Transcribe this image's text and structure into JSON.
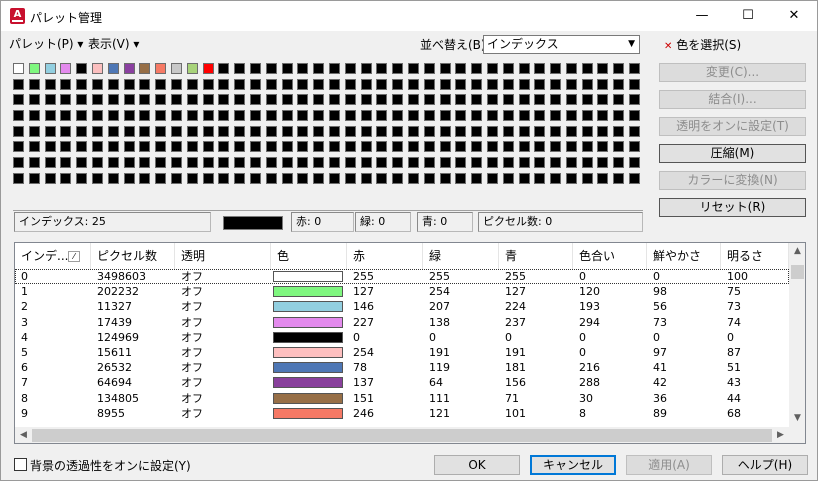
{
  "window": {
    "title": "パレット管理",
    "app_icon_letter": "A",
    "minimize": "—",
    "maximize": "☐",
    "close": "✕"
  },
  "menubar": {
    "palette_menu": "パレット(P) ▾",
    "view_menu": "表示(V) ▾",
    "sort_label": "並べ替え(B):",
    "sort_value": "インデックス",
    "pick_color": "色を選択(S)"
  },
  "palette": {
    "first_colors": [
      "#ffffff",
      "#7ff77f",
      "#92cfe0",
      "#e38aed",
      "#000000",
      "#fbbfbf",
      "#4e77b5",
      "#8a40a0",
      "#976f47",
      "#f67a65",
      "#c8c8c8",
      "#a8d37a",
      "#ff0000"
    ],
    "rest_color": "#000000",
    "total": 256
  },
  "side_buttons": {
    "change": "変更(C)...",
    "merge": "結合(I)...",
    "transparent_on": "透明をオンに設定(T)",
    "compress": "圧縮(M)",
    "convert": "カラーに変換(N)",
    "reset": "リセット(R)"
  },
  "info": {
    "index": "インデックス:  25",
    "red": "赤: 0",
    "green": "緑: 0",
    "blue": "青: 0",
    "pixels": "ピクセル数: 0",
    "current_color": "#000000"
  },
  "table": {
    "columns": [
      "インデ...",
      "ピクセル数",
      "透明",
      "色",
      "赤",
      "緑",
      "青",
      "色合い",
      "鮮やかさ",
      "明るさ"
    ],
    "rows": [
      {
        "idx": "0",
        "px": "3498603",
        "tr": "オフ",
        "color": "#ffffff",
        "r": "255",
        "g": "255",
        "b": "255",
        "h": "0",
        "s": "0",
        "l": "100"
      },
      {
        "idx": "1",
        "px": "202232",
        "tr": "オフ",
        "color": "#7ff77f",
        "r": "127",
        "g": "254",
        "b": "127",
        "h": "120",
        "s": "98",
        "l": "75"
      },
      {
        "idx": "2",
        "px": "11327",
        "tr": "オフ",
        "color": "#92cfe0",
        "r": "146",
        "g": "207",
        "b": "224",
        "h": "193",
        "s": "56",
        "l": "73"
      },
      {
        "idx": "3",
        "px": "17439",
        "tr": "オフ",
        "color": "#e38aed",
        "r": "227",
        "g": "138",
        "b": "237",
        "h": "294",
        "s": "73",
        "l": "74"
      },
      {
        "idx": "4",
        "px": "124969",
        "tr": "オフ",
        "color": "#000000",
        "r": "0",
        "g": "0",
        "b": "0",
        "h": "0",
        "s": "0",
        "l": "0"
      },
      {
        "idx": "5",
        "px": "15611",
        "tr": "オフ",
        "color": "#febfbf",
        "r": "254",
        "g": "191",
        "b": "191",
        "h": "0",
        "s": "97",
        "l": "87"
      },
      {
        "idx": "6",
        "px": "26532",
        "tr": "オフ",
        "color": "#4e77b5",
        "r": "78",
        "g": "119",
        "b": "181",
        "h": "216",
        "s": "41",
        "l": "51"
      },
      {
        "idx": "7",
        "px": "64694",
        "tr": "オフ",
        "color": "#89409c",
        "r": "137",
        "g": "64",
        "b": "156",
        "h": "288",
        "s": "42",
        "l": "43"
      },
      {
        "idx": "8",
        "px": "134805",
        "tr": "オフ",
        "color": "#976f47",
        "r": "151",
        "g": "111",
        "b": "71",
        "h": "30",
        "s": "36",
        "l": "44"
      },
      {
        "idx": "9",
        "px": "8955",
        "tr": "オフ",
        "color": "#f67965",
        "r": "246",
        "g": "121",
        "b": "101",
        "h": "8",
        "s": "89",
        "l": "68"
      }
    ]
  },
  "footer": {
    "bg_transparency": "背景の透過性をオンに設定(Y)",
    "ok": "OK",
    "cancel": "キャンセル",
    "apply": "適用(A)",
    "help": "ヘルプ(H)"
  }
}
